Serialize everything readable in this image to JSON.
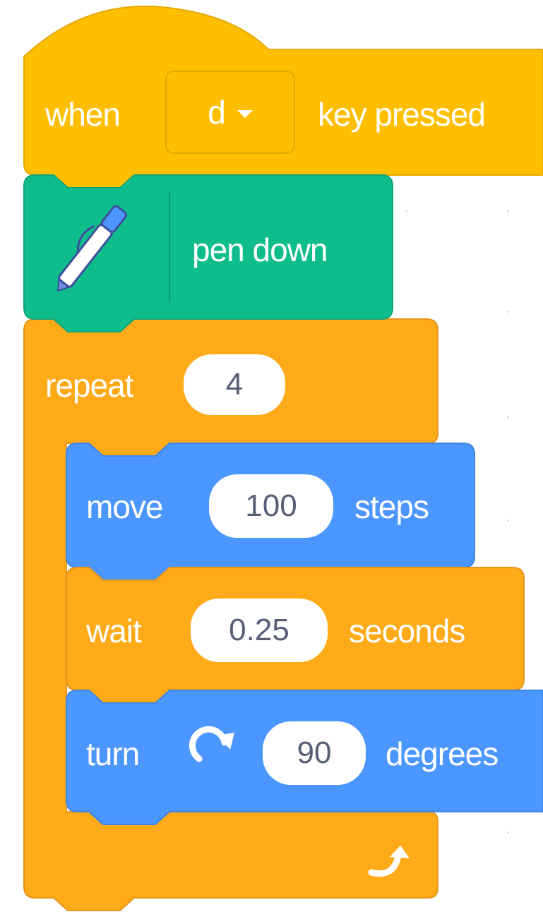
{
  "event_block": {
    "when_label": "when",
    "key_value": "d",
    "suffix_label": "key pressed",
    "color": "#ffbf00"
  },
  "pen_block": {
    "icon": "pen-icon",
    "label": "pen down",
    "color": "#0fbd8c"
  },
  "repeat_block": {
    "label": "repeat",
    "count": "4",
    "loop_icon": "loop-arrow-icon",
    "color": "#ffab19"
  },
  "move_block": {
    "label": "move",
    "value": "100",
    "suffix": "steps",
    "color": "#4c97ff"
  },
  "wait_block": {
    "label": "wait",
    "value": "0.25",
    "suffix": "seconds",
    "color": "#ffab19"
  },
  "turn_block": {
    "label": "turn",
    "icon": "rotate-right-icon",
    "value": "90",
    "suffix": "degrees",
    "color": "#4c97ff"
  }
}
